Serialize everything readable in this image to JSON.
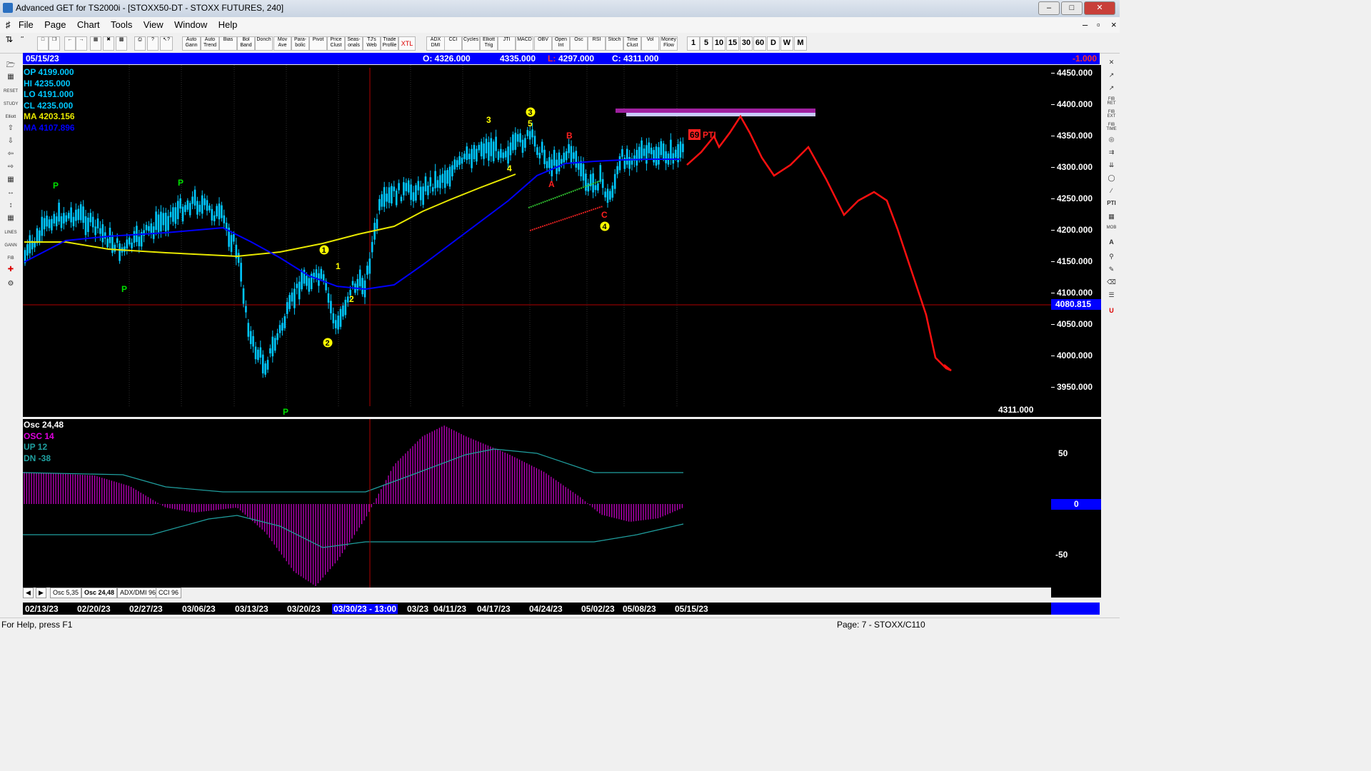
{
  "window": {
    "title": "Advanced GET for TS2000i - [STOXX50-DT - STOXX FUTURES, 240]"
  },
  "menu": [
    "File",
    "Page",
    "Chart",
    "Tools",
    "View",
    "Window",
    "Help"
  ],
  "toolbar": {
    "buttons": [
      "Auto Gann",
      "Auto Trend",
      "Bias",
      "Bol Band",
      "Donch",
      "Mov Ave",
      "Para- bolic",
      "Pivot",
      "Price Clust",
      "Seas- onals",
      "TJ's Web",
      "Trade Profile",
      "XTL",
      "ADX DMI",
      "CCI",
      "Cycles",
      "Elliott Trig",
      "JTI",
      "MACD",
      "OBV",
      "Open Int",
      "Osc",
      "RSI",
      "Stoch",
      "Time Clust",
      "Vol",
      "Money Flow"
    ],
    "intervals": [
      "1",
      "5",
      "10",
      "15",
      "30",
      "60",
      "D",
      "W",
      "M"
    ]
  },
  "infobar": {
    "date": "05/15/23",
    "open": "O: 4326.000",
    "high": "4335.000",
    "low_label": "L:",
    "low": "4297.000",
    "close": "C: 4311.000",
    "change": "-1.000"
  },
  "legend": {
    "op": "OP 4199.000",
    "hi": "HI  4235.000",
    "lo": "LO  4191.000",
    "cl": "CL  4235.000",
    "ma1": "MA 4203.156",
    "ma2": "MA 4107.896"
  },
  "price_scale": {
    "labels": [
      "4450.000",
      "4400.000",
      "4350.000",
      "4300.000",
      "4250.000",
      "4200.000",
      "4150.000",
      "4100.000",
      "4050.000",
      "4000.000",
      "3950.000"
    ],
    "cursor_value": "4080.815",
    "last_value": "4311.000"
  },
  "osc_legend": {
    "title": "Osc 24,48",
    "osc": "OSC 14",
    "up": "UP  12",
    "dn": "DN  -38"
  },
  "osc_scale": {
    "labels": [
      "50",
      "-50"
    ],
    "zero": "0"
  },
  "tabs": [
    "Osc 5,35",
    "Osc 24,48",
    "ADX/DMI 96",
    "CCI 96"
  ],
  "dates": [
    "02/13/23",
    "02/20/23",
    "02/27/23",
    "03/06/23",
    "03/13/23",
    "03/20/23",
    "03/30/23 - 13:00",
    "03/23",
    "04/11/23",
    "04/17/23",
    "04/24/23",
    "05/02/23",
    "05/08/23",
    "05/15/23"
  ],
  "status": {
    "help": "For Help, press F1",
    "page": "Page: 7 - STOXX/C110"
  },
  "annotations": {
    "pivot": "P",
    "wave_1": "1",
    "wave_2": "2",
    "wave_3": "3",
    "wave_4": "4",
    "wave_5": "5",
    "abc_a": "A",
    "abc_b": "B",
    "abc_c": "C",
    "pti_value": "69",
    "pti_label": "PTI"
  },
  "colors": {
    "candle": "#00c8ff",
    "ma_slow": "#0000ff",
    "ma_fast": "#e8e800",
    "projection": "#ff1010",
    "osc": "#c000c0",
    "band": "#20a0a0",
    "pivot": "#00e000",
    "wave_circle": "#ffff00",
    "accent": "#0000ff"
  }
}
